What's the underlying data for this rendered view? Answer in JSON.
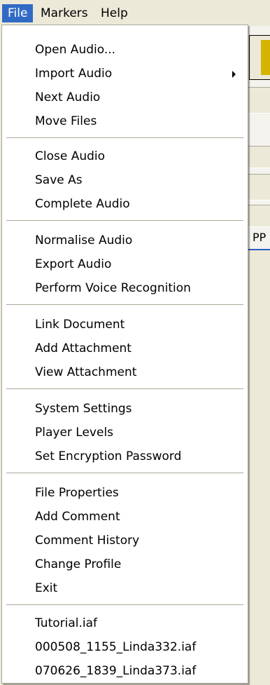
{
  "menubar": {
    "items": [
      "File",
      "Markers",
      "Help"
    ]
  },
  "background": {
    "partial_text": "PP"
  },
  "file_menu": {
    "groups": [
      {
        "items": [
          {
            "label": "Open Audio...",
            "submenu": false
          },
          {
            "label": "Import Audio",
            "submenu": true
          },
          {
            "label": "Next Audio",
            "submenu": false
          },
          {
            "label": "Move Files",
            "submenu": false
          }
        ]
      },
      {
        "items": [
          {
            "label": "Close Audio"
          },
          {
            "label": "Save As"
          },
          {
            "label": "Complete Audio"
          }
        ]
      },
      {
        "items": [
          {
            "label": "Normalise Audio"
          },
          {
            "label": "Export Audio"
          },
          {
            "label": "Perform Voice Recognition"
          }
        ]
      },
      {
        "items": [
          {
            "label": "Link Document"
          },
          {
            "label": "Add Attachment"
          },
          {
            "label": "View Attachment"
          }
        ]
      },
      {
        "items": [
          {
            "label": "System Settings"
          },
          {
            "label": "Player Levels"
          },
          {
            "label": "Set Encryption Password"
          }
        ]
      },
      {
        "items": [
          {
            "label": "File Properties"
          },
          {
            "label": "Add Comment"
          },
          {
            "label": "Comment History"
          },
          {
            "label": "Change Profile"
          },
          {
            "label": "Exit"
          }
        ]
      },
      {
        "items": [
          {
            "label": "Tutorial.iaf"
          },
          {
            "label": "000508_1155_Linda332.iaf"
          },
          {
            "label": "070626_1839_Linda373.iaf"
          }
        ]
      }
    ]
  },
  "colors": {
    "highlight": "#316ac5",
    "menu_bg": "#ffffff",
    "chrome": "#ece9d8"
  }
}
